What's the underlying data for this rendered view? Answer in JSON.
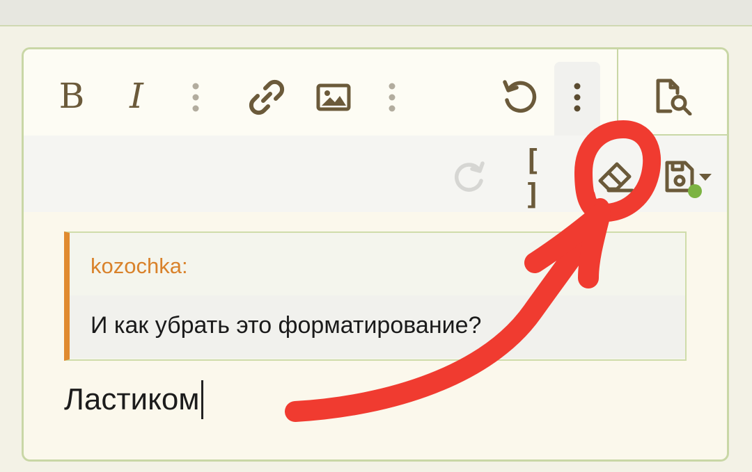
{
  "toolbar": {
    "bold_label": "B",
    "italic_label": "I",
    "brackets_label": "[ ]",
    "icons": [
      "bold-icon",
      "italic-icon",
      "more-vertical-icon",
      "link-icon",
      "image-icon",
      "more-vertical-icon",
      "undo-icon",
      "more-vertical-icon",
      "preview-icon",
      "redo-icon",
      "brackets-icon",
      "eraser-icon",
      "save-draft-icon",
      "dropdown-caret-icon"
    ],
    "draft_status_color": "#7cb342"
  },
  "quote": {
    "author": "kozochka:",
    "text": "И как убрать это форматирование?"
  },
  "editor": {
    "text": "Ластиком"
  },
  "colors": {
    "icon": "#6b5a3a",
    "border": "#c9d7a6",
    "quote_accent": "#e08a2f",
    "annotation": "#f03b30"
  }
}
